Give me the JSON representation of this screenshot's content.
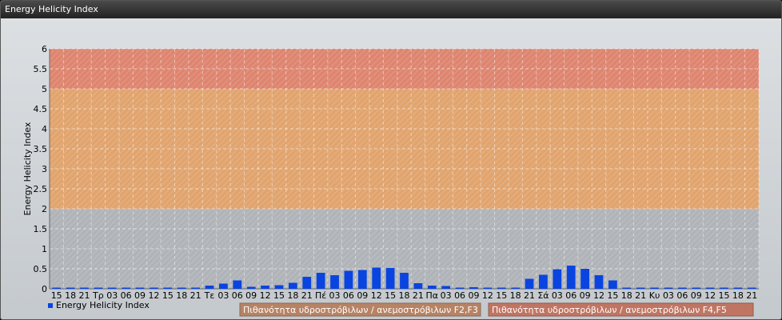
{
  "header": {
    "title": "Energy Helicity Index"
  },
  "colors": {
    "bar": "#0a44e0",
    "band_low": "#b0b4b8",
    "band_mid": "#e1a46e",
    "band_high": "#de8570",
    "legend_mid": "#b68365",
    "legend_high": "#c07563"
  },
  "chart_data": {
    "type": "bar",
    "title": "",
    "ylabel": "Energy Helicity Index",
    "xlabel": "",
    "ylim": [
      0,
      6
    ],
    "yticks": [
      "0",
      "0.5",
      "1",
      "1.5",
      "2",
      "2.5",
      "3",
      "3.5",
      "4",
      "4.5",
      "5",
      "5.5",
      "6"
    ],
    "grid": true,
    "categories": [
      "15",
      "18",
      "21",
      "Τρ",
      "03",
      "06",
      "09",
      "12",
      "15",
      "18",
      "21",
      "Τε",
      "03",
      "06",
      "09",
      "12",
      "15",
      "18",
      "21",
      "Πέ",
      "03",
      "06",
      "09",
      "12",
      "15",
      "18",
      "21",
      "Πα",
      "03",
      "06",
      "09",
      "12",
      "15",
      "18",
      "21",
      "Σά",
      "03",
      "06",
      "09",
      "12",
      "15",
      "18",
      "21",
      "Κυ",
      "03",
      "06",
      "09",
      "12",
      "15",
      "18",
      "21"
    ],
    "series": [
      {
        "name": "Energy Helicity Index",
        "values": [
          0,
          0,
          0,
          0,
          0,
          0,
          0,
          0,
          0,
          0,
          0,
          0.08,
          0.13,
          0.21,
          0.05,
          0.08,
          0.09,
          0.15,
          0.3,
          0.4,
          0.34,
          0.45,
          0.47,
          0.53,
          0.52,
          0.4,
          0.14,
          0.08,
          0.07,
          0.03,
          0.04,
          0,
          0,
          0,
          0.25,
          0.35,
          0.49,
          0.58,
          0.5,
          0.34,
          0.21,
          0,
          0,
          0,
          0,
          0,
          0,
          0,
          0,
          0,
          0
        ]
      }
    ],
    "bands": [
      {
        "from": 0,
        "to": 2,
        "color": "#b0b4b8"
      },
      {
        "from": 2,
        "to": 5,
        "color": "#e1a46e"
      },
      {
        "from": 5,
        "to": 6,
        "color": "#de8570"
      }
    ],
    "legend": "bottom-left"
  },
  "legend": {
    "series_label": "Energy Helicity Index",
    "band_mid_label": "Πιθανότητα υδροστρόβιλων / ανεμοστρόβιλων F2,F3",
    "band_high_label": "Πιθανότητα υδροστρόβιλων / ανεμοστρόβιλων F4,F5"
  }
}
